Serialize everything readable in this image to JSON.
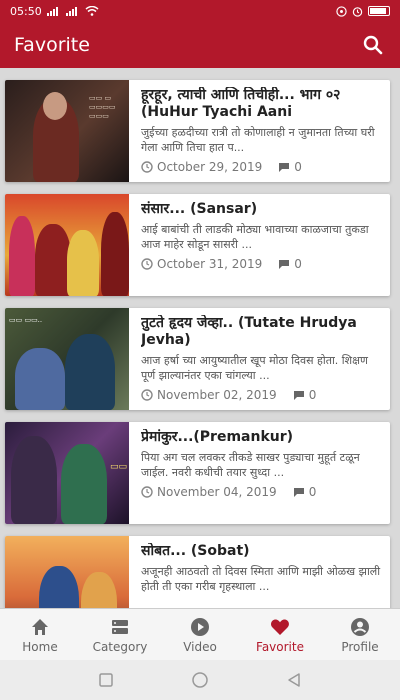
{
  "status_bar": {
    "time": "05:50"
  },
  "app_bar": {
    "title": "Favorite"
  },
  "colors": {
    "primary": "#b2182b"
  },
  "stories": [
    {
      "title": "हूरहूर, त्याची आणि तिचीही... भाग ०२ (HuHur Tyachi Aani",
      "excerpt": "जुईच्या हळदीच्या रात्री तो कोणालाही न जुमानता तिच्या घरी गेला आणि तिचा हात प...",
      "date": "October 29, 2019",
      "comments": "0"
    },
    {
      "title": "संसार... (Sansar)",
      "excerpt": "आई बाबांची ती लाडकी मोठ्या भावाच्या काळजाचा तुकडा आज माहेर सोडून सासरी ...",
      "date": "October 31, 2019",
      "comments": "0"
    },
    {
      "title": "तुटते हृदय जेव्हा.. (Tutate Hrudya Jevha)",
      "excerpt": "आज हर्षा च्या आयुष्यातील खूप मोठा दिवस होता. शिक्षण पूर्ण झाल्यानंतर एका चांगल्या ...",
      "date": "November 02, 2019",
      "comments": "0"
    },
    {
      "title": "प्रेमांकुर...(Premankur)",
      "excerpt": "पिया अग चल लवकर तीकडे साखर पुड्याचा मुहूर्त टळून जाईल. नवरी कधीची तयार सुध्दा ...",
      "date": "November 04, 2019",
      "comments": "0"
    },
    {
      "title": "सोबत... (Sobat)",
      "excerpt": "अजूनही आठवतो तो दिवस स्मिता आणि माझी ओळख झाली होती ती एका गरीब गृहस्थाला ...",
      "date": "",
      "comments": ""
    }
  ],
  "bottom_nav": [
    {
      "label": "Home",
      "icon": "home-icon"
    },
    {
      "label": "Category",
      "icon": "category-icon"
    },
    {
      "label": "Video",
      "icon": "video-icon"
    },
    {
      "label": "Favorite",
      "icon": "heart-icon",
      "active": true
    },
    {
      "label": "Profile",
      "icon": "profile-icon"
    }
  ]
}
